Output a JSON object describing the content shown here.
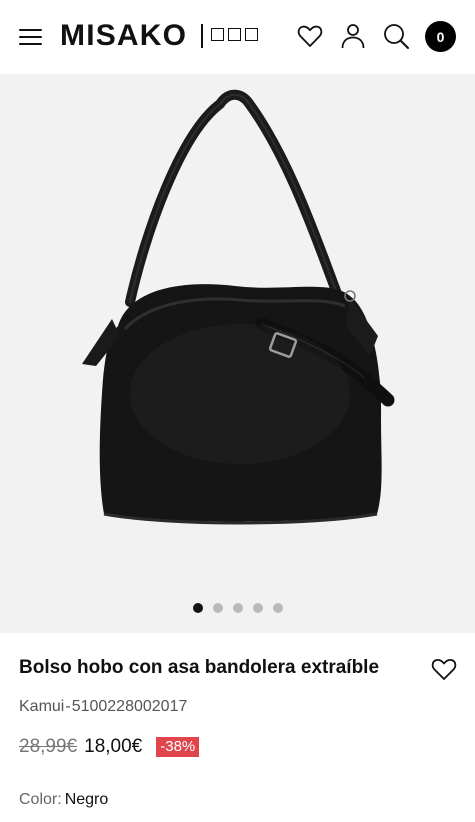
{
  "header": {
    "menu_icon": "hamburger-menu-icon",
    "logo_text": "MISAKO",
    "icons": [
      "heart-icon",
      "user-icon",
      "search-icon",
      "cart-icon"
    ],
    "cart_count": "0"
  },
  "gallery": {
    "image_alt": "Bolso hobo negro",
    "slides_total": 5,
    "active_slide": 1
  },
  "product": {
    "title": "Bolso hobo con asa bandolera extraíble",
    "model": "Kamui",
    "ref_separator": "-",
    "sku": "5100228002017",
    "old_price": "28,99€",
    "price": "18,00€",
    "discount": "-38%",
    "color_label": "Color:",
    "color_value": "Negro"
  },
  "colors": {
    "discount_badge": "#e0454b",
    "gallery_bg": "#f2f2f2"
  }
}
